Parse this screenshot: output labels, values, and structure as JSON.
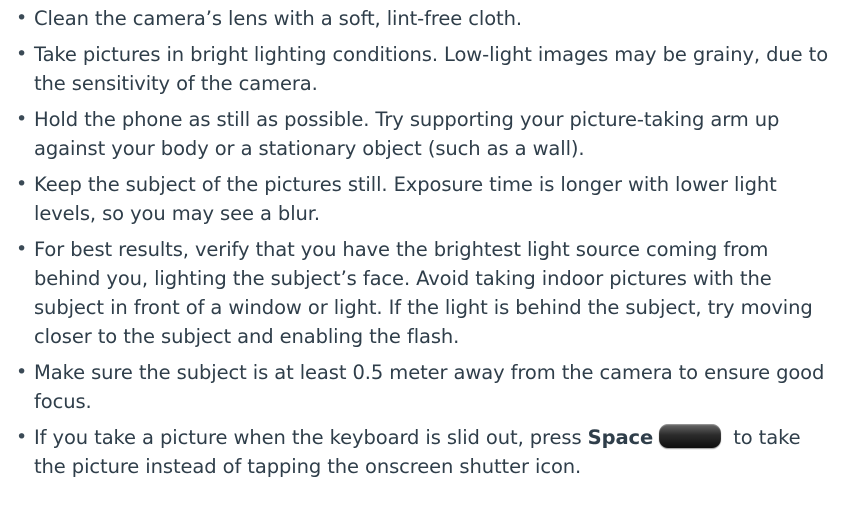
{
  "tips": [
    {
      "text": "Clean the camera’s lens with a soft, lint-free cloth."
    },
    {
      "text": "Take pictures in bright lighting conditions. Low-light images may be grainy, due to the sensitivity of the camera."
    },
    {
      "text": "Hold the phone as still as possible. Try supporting your picture-taking arm up against your body or a stationary object (such as a wall)."
    },
    {
      "text": "Keep the subject of the pictures still. Exposure time is longer with lower light levels, so you may see a blur."
    },
    {
      "text": "For best results, verify that you have the brightest light source coming from behind you, lighting the subject’s face. Avoid taking indoor pictures with the subject in front of a window or light. If the light is behind the subject, try moving closer to the subject and enabling the flash."
    },
    {
      "text": "Make sure the subject is at least 0.5 meter away from the camera to ensure good focus."
    },
    {
      "prefix": "If you take a picture when the keyboard is slid out, press ",
      "key_label": "Space",
      "key_icon": "space-key-icon",
      "suffix": " to take the picture instead of tapping the onscreen shutter icon."
    }
  ],
  "bullet_glyph": "•"
}
